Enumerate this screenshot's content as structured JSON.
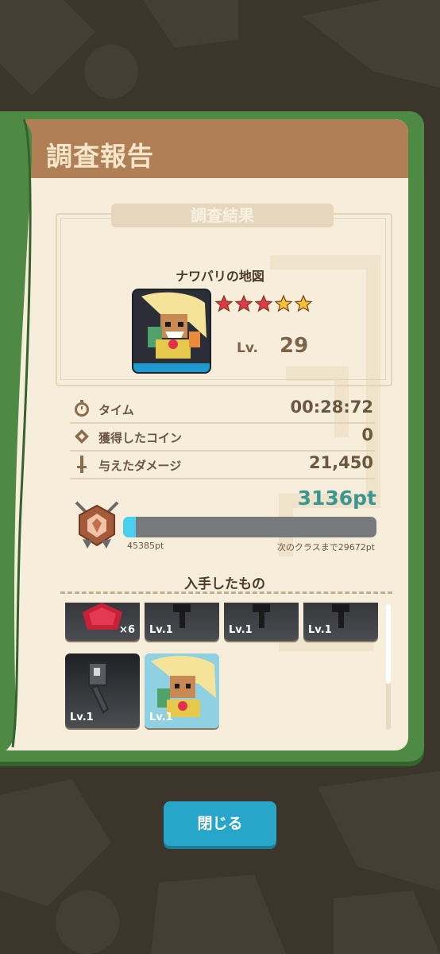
{
  "report": {
    "title": "調査報告",
    "section_title": "調査結果",
    "item_name": "ナワバリの地図",
    "stars_filled_red": 3,
    "stars_total": 5,
    "level_label": "Lv.",
    "level_value": "29"
  },
  "stats": [
    {
      "icon": "stopwatch-icon",
      "label": "タイム",
      "value": "00:28:72"
    },
    {
      "icon": "coin-icon",
      "label": "獲得したコイン",
      "value": "0"
    },
    {
      "icon": "sword-icon",
      "label": "与えたダメージ",
      "value": "21,450"
    }
  ],
  "progress": {
    "points": "3136pt",
    "current_total": "45385pt",
    "next_class": "次のクラスまで29672pt",
    "fill_fraction": 0.05
  },
  "obtained": {
    "title": "入手したもの",
    "items": [
      {
        "kind": "gem",
        "label": "",
        "qty": "×6"
      },
      {
        "kind": "hammer",
        "label": "Lv.1",
        "qty": ""
      },
      {
        "kind": "hammer",
        "label": "Lv.1",
        "qty": ""
      },
      {
        "kind": "hammer",
        "label": "Lv.1",
        "qty": ""
      },
      {
        "kind": "weapon",
        "label": "Lv.1",
        "qty": ""
      },
      {
        "kind": "character",
        "label": "Lv.1",
        "qty": ""
      }
    ]
  },
  "buttons": {
    "close": "閉じる"
  },
  "colors": {
    "accent": "#28a6c9",
    "points": "#3a9690",
    "bar_fill": "#49d0ef",
    "header": "#b17f55",
    "book_green": "#4f8a44"
  }
}
